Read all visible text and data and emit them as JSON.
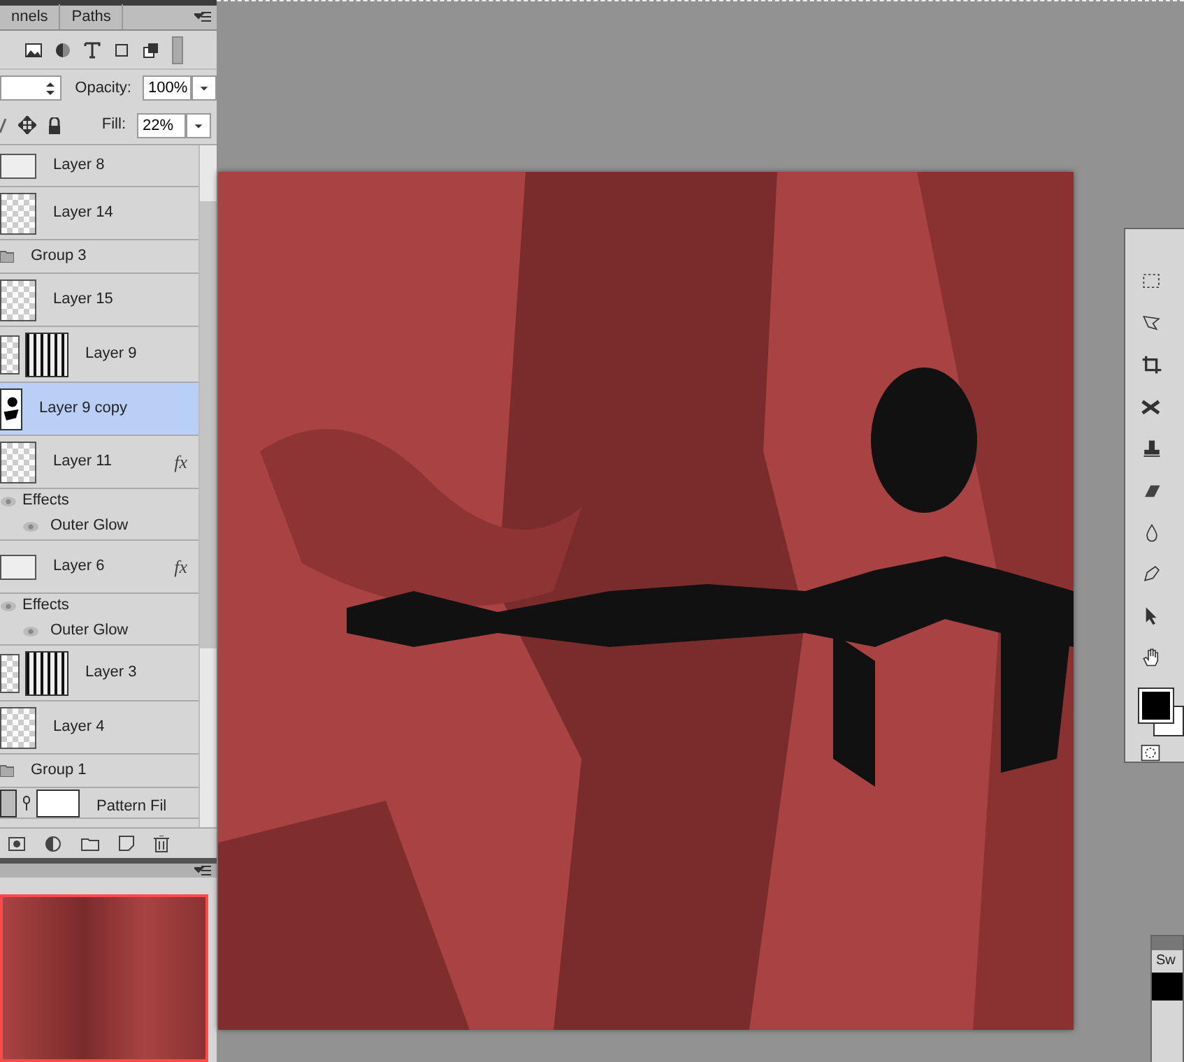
{
  "panel_tabs": [
    {
      "label": "nnels"
    },
    {
      "label": "Paths"
    }
  ],
  "opacity": {
    "label": "Opacity:",
    "value": "100%"
  },
  "fill": {
    "label": "Fill:",
    "value": "22%"
  },
  "layers": [
    {
      "kind": "layer",
      "name": "Layer 8",
      "selected": false,
      "thumb": {
        "kind": "light"
      }
    },
    {
      "kind": "layer",
      "name": "Layer 14",
      "selected": false,
      "thumb": {
        "kind": "checker"
      }
    },
    {
      "kind": "group",
      "name": "Group 3",
      "selected": false
    },
    {
      "kind": "layer",
      "name": "Layer 15",
      "selected": false,
      "thumb": {
        "kind": "checker"
      }
    },
    {
      "kind": "masked",
      "name": "Layer 9",
      "selected": false
    },
    {
      "kind": "layer",
      "name": "Layer 9 copy",
      "selected": true,
      "thumb": {
        "kind": "figure"
      }
    },
    {
      "kind": "layer",
      "name": "Layer 11",
      "selected": false,
      "thumb": {
        "kind": "checker"
      },
      "fx": "fx",
      "effects": {
        "label": "Effects",
        "children": [
          {
            "label": "Outer Glow"
          }
        ]
      }
    },
    {
      "kind": "layer",
      "name": "Layer 6",
      "selected": false,
      "thumb": {
        "kind": "light"
      },
      "fx": "fx",
      "effects": {
        "label": "Effects",
        "children": [
          {
            "label": "Outer Glow"
          }
        ]
      }
    },
    {
      "kind": "masked",
      "name": "Layer 3",
      "selected": false
    },
    {
      "kind": "layer",
      "name": "Layer 4",
      "selected": false,
      "thumb": {
        "kind": "checker"
      }
    },
    {
      "kind": "group",
      "name": "Group 1",
      "selected": false
    },
    {
      "kind": "fill",
      "name": "Pattern Fil",
      "selected": false
    }
  ],
  "swatches_tab": {
    "label": "Sw"
  }
}
